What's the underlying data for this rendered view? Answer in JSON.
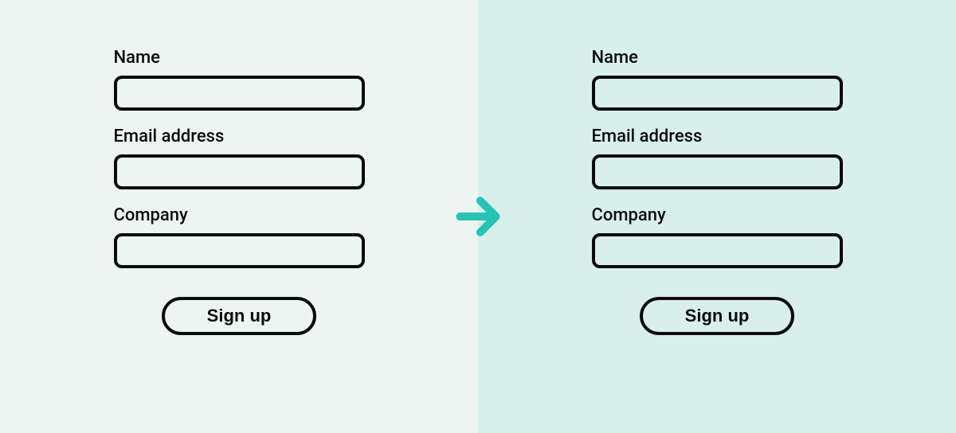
{
  "leftForm": {
    "fields": [
      {
        "label": "Name"
      },
      {
        "label": "Email address"
      },
      {
        "label": "Company"
      }
    ],
    "buttonLabel": "Sign up"
  },
  "rightForm": {
    "fields": [
      {
        "label": "Name"
      },
      {
        "label": "Email address"
      },
      {
        "label": "Company"
      }
    ],
    "buttonLabel": "Sign up"
  },
  "colors": {
    "leftBg": "#ecf5f2",
    "rightBg": "#d8efeb",
    "stroke": "#0c0c0c",
    "arrow": "#28c4b3"
  }
}
